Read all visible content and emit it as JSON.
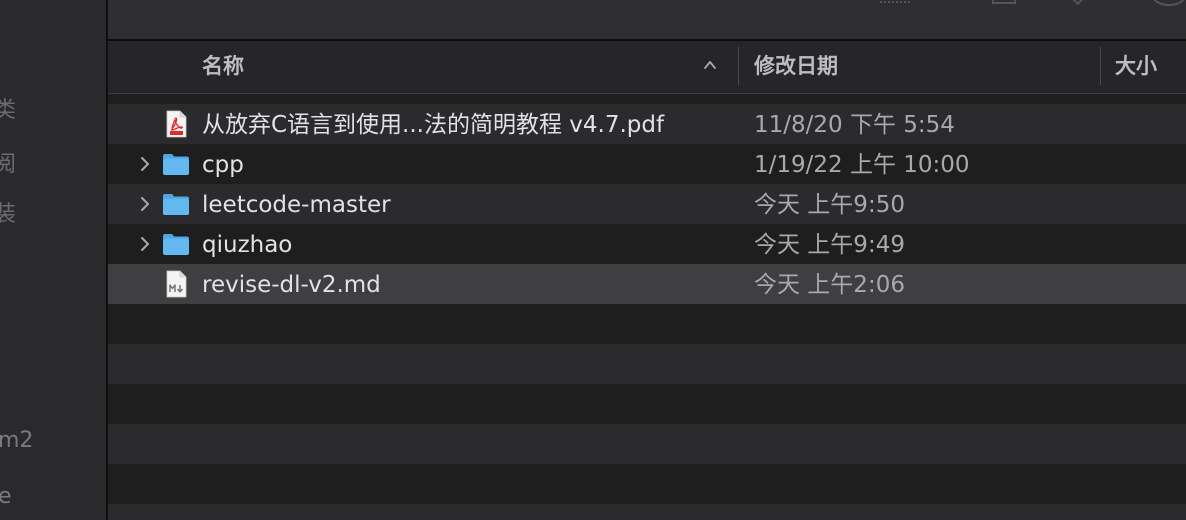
{
  "sidebar": {
    "fragments": [
      "类",
      "阅",
      "装",
      "m2",
      "e"
    ]
  },
  "header": {
    "columns": [
      {
        "label": "名称"
      },
      {
        "label": "修改日期"
      },
      {
        "label": "大小"
      }
    ]
  },
  "files": [
    {
      "name": "从放弃C语言到使用...法的简明教程 v4.7.pdf",
      "date": "11/8/20 下午 5:54",
      "icon": "pdf-file-icon",
      "expandable": false
    },
    {
      "name": "cpp",
      "date": "1/19/22 上午 10:00",
      "icon": "folder-icon",
      "expandable": true
    },
    {
      "name": "leetcode-master",
      "date": "今天 上午9:50",
      "icon": "folder-icon",
      "expandable": true
    },
    {
      "name": "qiuzhao",
      "date": "今天 上午9:49",
      "icon": "folder-icon",
      "expandable": true
    },
    {
      "name": "revise-dl-v2.md",
      "date": "今天 上午2:06",
      "icon": "markdown-file-icon",
      "expandable": false
    }
  ],
  "colors": {
    "background": "#1f1e1f",
    "stripe": "#2b2a2c",
    "selected_row": "#3f3e40",
    "folder": "#5fb4ec",
    "pdf_red": "#e02a24",
    "text": "#e2e1e5",
    "secondary_text": "#a9a8ac"
  }
}
